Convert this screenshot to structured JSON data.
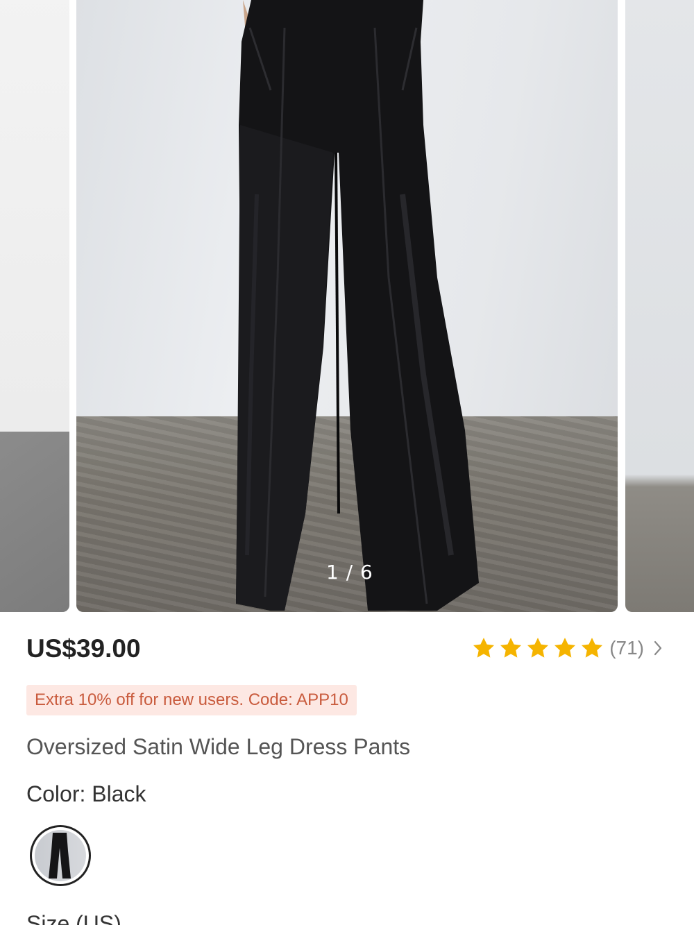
{
  "gallery": {
    "counter": "1 / 6",
    "current": 1,
    "total": 6
  },
  "product": {
    "price": "US$39.00",
    "rating": {
      "stars": 5,
      "count_label": "(71)"
    },
    "promo": "Extra 10% off for new users. Code: APP10",
    "title": "Oversized Satin Wide Leg Dress Pants",
    "color_label": "Color: Black",
    "size_label": "Size (US)"
  },
  "colors": {
    "star": "#f5b400",
    "promo_bg": "#fde8e3",
    "promo_text": "#c95b3d",
    "price_text": "#222222"
  },
  "icons": {
    "rating_star": "star-icon",
    "reviews_more": "chevron-right-icon"
  }
}
